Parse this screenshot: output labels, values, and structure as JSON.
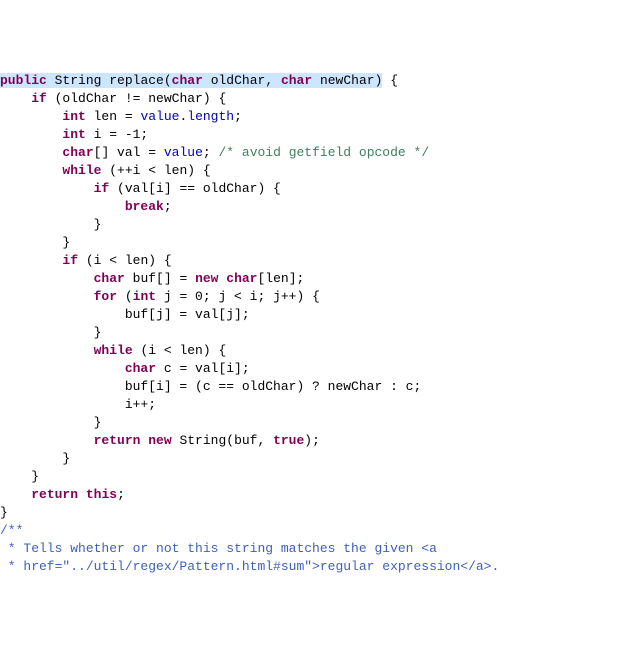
{
  "chart_data": {
    "type": "table",
    "title": "Java source code: String.replace(char, char)",
    "language": "java",
    "tokens_per_line": [
      [
        [
          "kw hl",
          "public"
        ],
        [
          "hl",
          " "
        ],
        [
          "typ hl",
          "String"
        ],
        [
          "hl",
          " "
        ],
        [
          "hl",
          "replace"
        ],
        [
          "p hl",
          "("
        ],
        [
          "kw hl",
          "char"
        ],
        [
          "hl",
          " oldChar"
        ],
        [
          "p hl",
          ","
        ],
        [
          "hl",
          " "
        ],
        [
          "kw hl",
          "char"
        ],
        [
          "hl",
          " newChar"
        ],
        [
          "p hl",
          ")"
        ],
        [
          "p",
          " {"
        ]
      ],
      [
        [
          "p",
          "    "
        ],
        [
          "kw",
          "if"
        ],
        [
          "p",
          " (oldChar != newChar) {"
        ]
      ],
      [
        [
          "p",
          "        "
        ],
        [
          "kw",
          "int"
        ],
        [
          "p",
          " len = "
        ],
        [
          "id",
          "value"
        ],
        [
          "p",
          "."
        ],
        [
          "id",
          "length"
        ],
        [
          "p",
          ";"
        ]
      ],
      [
        [
          "p",
          "        "
        ],
        [
          "kw",
          "int"
        ],
        [
          "p",
          " i = -1;"
        ]
      ],
      [
        [
          "p",
          "        "
        ],
        [
          "kw",
          "char"
        ],
        [
          "p",
          "[] val = "
        ],
        [
          "id",
          "value"
        ],
        [
          "p",
          "; "
        ],
        [
          "cm",
          "/* avoid getfield opcode */"
        ]
      ],
      [
        [
          "p",
          ""
        ]
      ],
      [
        [
          "p",
          "        "
        ],
        [
          "kw",
          "while"
        ],
        [
          "p",
          " (++i < len) {"
        ]
      ],
      [
        [
          "p",
          "            "
        ],
        [
          "kw",
          "if"
        ],
        [
          "p",
          " (val[i] == oldChar) {"
        ]
      ],
      [
        [
          "p",
          "                "
        ],
        [
          "kw",
          "break"
        ],
        [
          "p",
          ";"
        ]
      ],
      [
        [
          "p",
          "            }"
        ]
      ],
      [
        [
          "p",
          "        }"
        ]
      ],
      [
        [
          "p",
          "        "
        ],
        [
          "kw",
          "if"
        ],
        [
          "p",
          " (i < len) {"
        ]
      ],
      [
        [
          "p",
          "            "
        ],
        [
          "kw",
          "char"
        ],
        [
          "p",
          " buf[] = "
        ],
        [
          "kw",
          "new"
        ],
        [
          "p",
          " "
        ],
        [
          "kw",
          "char"
        ],
        [
          "p",
          "[len];"
        ]
      ],
      [
        [
          "p",
          "            "
        ],
        [
          "kw",
          "for"
        ],
        [
          "p",
          " ("
        ],
        [
          "kw",
          "int"
        ],
        [
          "p",
          " j = 0; j < i; j++) {"
        ]
      ],
      [
        [
          "p",
          "                buf[j] = val[j];"
        ]
      ],
      [
        [
          "p",
          "            }"
        ]
      ],
      [
        [
          "p",
          "            "
        ],
        [
          "kw",
          "while"
        ],
        [
          "p",
          " (i < len) {"
        ]
      ],
      [
        [
          "p",
          "                "
        ],
        [
          "kw",
          "char"
        ],
        [
          "p",
          " c = val[i];"
        ]
      ],
      [
        [
          "p",
          "                buf[i] = (c == oldChar) ? newChar : c;"
        ]
      ],
      [
        [
          "p",
          "                i++;"
        ]
      ],
      [
        [
          "p",
          "            }"
        ]
      ],
      [
        [
          "p",
          "            "
        ],
        [
          "kw",
          "return"
        ],
        [
          "p",
          " "
        ],
        [
          "kw",
          "new"
        ],
        [
          "p",
          " String(buf, "
        ],
        [
          "kw",
          "true"
        ],
        [
          "p",
          ");"
        ]
      ],
      [
        [
          "p",
          "        }"
        ]
      ],
      [
        [
          "p",
          "    }"
        ]
      ],
      [
        [
          "p",
          "    "
        ],
        [
          "kw",
          "return"
        ],
        [
          "p",
          " "
        ],
        [
          "kw",
          "this"
        ],
        [
          "p",
          ";"
        ]
      ],
      [
        [
          "p",
          "}"
        ]
      ],
      [
        [
          "p",
          ""
        ]
      ],
      [
        [
          "doc",
          "/**"
        ]
      ],
      [
        [
          "doc",
          " * Tells whether or not this string matches the given <a"
        ]
      ],
      [
        [
          "doc",
          " * href=\"../util/regex/Pattern.html#sum\">regular expression</a>."
        ]
      ]
    ]
  }
}
